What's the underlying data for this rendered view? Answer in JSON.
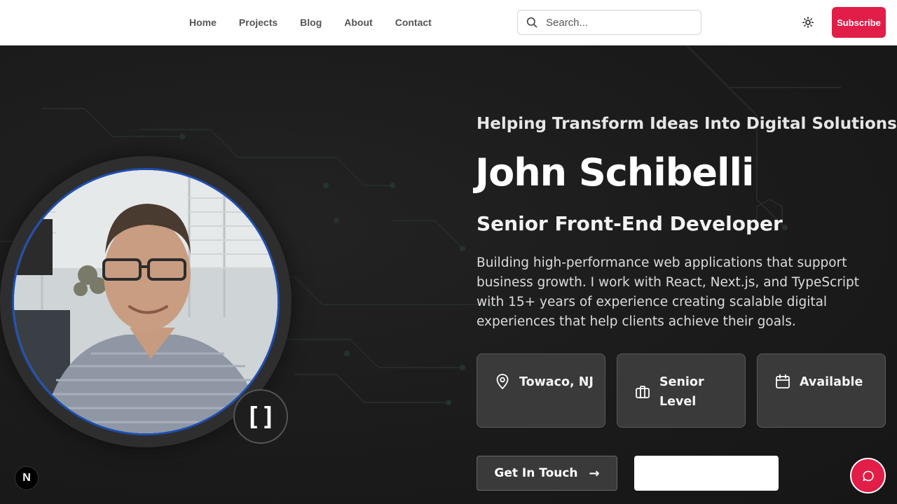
{
  "nav": {
    "items": [
      {
        "label": "Home"
      },
      {
        "label": "Projects"
      },
      {
        "label": "Blog"
      },
      {
        "label": "About"
      },
      {
        "label": "Contact"
      }
    ]
  },
  "search": {
    "placeholder": "Search...",
    "value": ""
  },
  "header": {
    "subscribe_label": "Subscribe",
    "theme_icon": "sun-icon"
  },
  "hero": {
    "tagline": "Helping Transform Ideas Into Digital Solutions",
    "name": "John Schibelli",
    "role": "Senior Front-End Developer",
    "bio": "Building high-performance web applications that support business growth. I work with React, Next.js, and TypeScript with 15+ years of experience creating scalable digital experiences that help clients achieve their goals.",
    "code_badge": "[]",
    "cards": [
      {
        "label": "Towaco, NJ",
        "icon": "map-pin-icon"
      },
      {
        "label": "Senior Level",
        "icon": "briefcase-icon"
      },
      {
        "label": "Available",
        "icon": "calendar-icon"
      }
    ],
    "primary_button": "Get In Touch",
    "primary_button_arrow": "→"
  },
  "footer_badge": {
    "label": "N"
  },
  "colors": {
    "accent": "#e11d48",
    "background": "#1a1a1a",
    "avatar_ring": "#1e4fb3"
  }
}
